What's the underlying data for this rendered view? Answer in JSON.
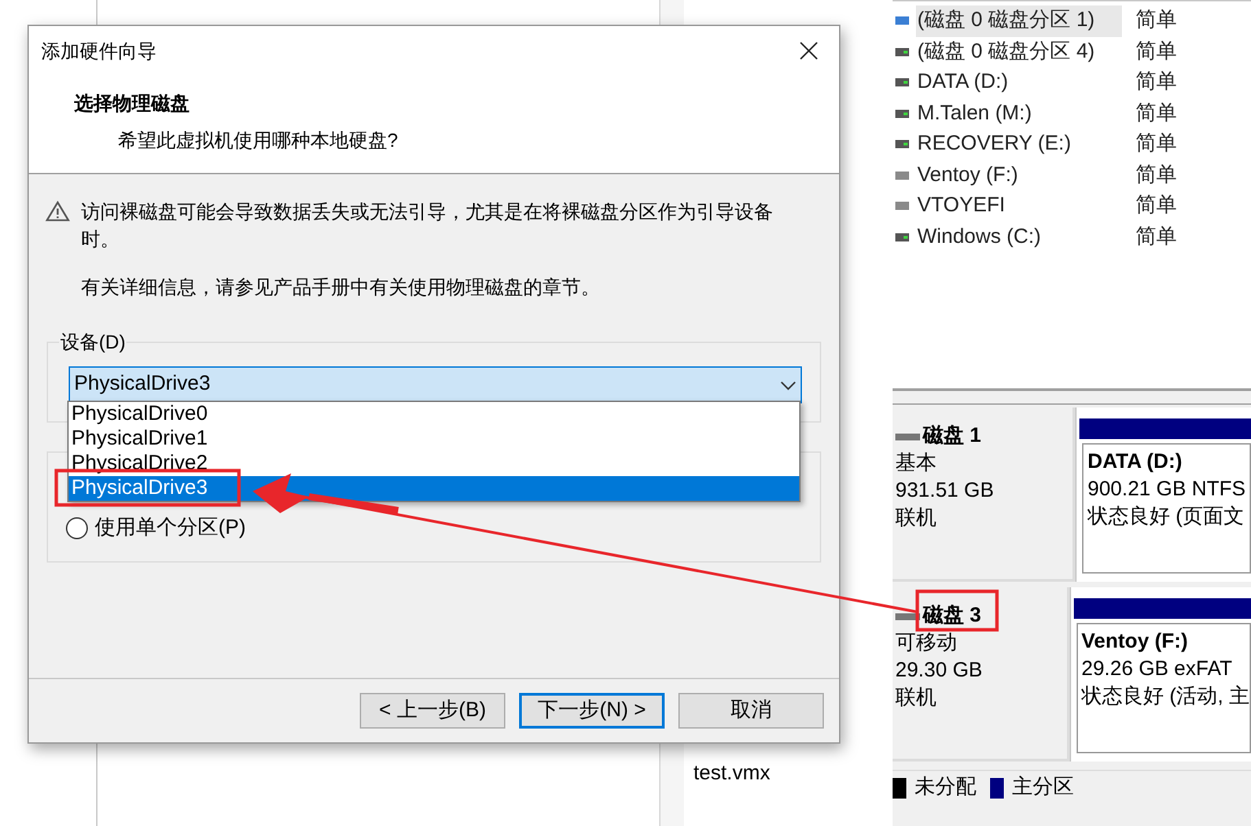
{
  "background_window": {
    "file": "test.vmx"
  },
  "dialog": {
    "title": "添加硬件向导",
    "heading": "选择物理磁盘",
    "subheading": "希望此虚拟机使用哪种本地硬盘?",
    "warning": "访问裸磁盘可能会导致数据丢失或无法引导，尤其是在将裸磁盘分区作为引导设备时。",
    "info": "有关详细信息，请参见产品手册中有关使用物理磁盘的章节。",
    "device": {
      "label": "设备(D)",
      "value": "PhysicalDrive3",
      "options": [
        {
          "label": "PhysicalDrive0",
          "selected": false
        },
        {
          "label": "PhysicalDrive1",
          "selected": false
        },
        {
          "label": "PhysicalDrive2",
          "selected": false
        },
        {
          "label": "PhysicalDrive3",
          "selected": true
        }
      ]
    },
    "partition_option": {
      "label": "使用单个分区(P)",
      "selected": false
    },
    "buttons": [
      {
        "label": "< 上一步(B)",
        "default": false
      },
      {
        "label": "下一步(N) >",
        "default": true
      },
      {
        "label": "取消",
        "default": false
      }
    ]
  },
  "volumes": [
    {
      "name": "(磁盘 0 磁盘分区 1)",
      "layout": "简单",
      "kind": "system",
      "selected": true
    },
    {
      "name": "(磁盘 0 磁盘分区 4)",
      "layout": "简单",
      "kind": "basic",
      "selected": false
    },
    {
      "name": "DATA (D:)",
      "layout": "简单",
      "kind": "basic",
      "selected": false
    },
    {
      "name": "M.Talen (M:)",
      "layout": "简单",
      "kind": "basic",
      "selected": false
    },
    {
      "name": "RECOVERY (E:)",
      "layout": "简单",
      "kind": "basic",
      "selected": false
    },
    {
      "name": "Ventoy (F:)",
      "layout": "简单",
      "kind": "removable",
      "selected": false
    },
    {
      "name": "VTOYEFI",
      "layout": "简单",
      "kind": "removable",
      "selected": false
    },
    {
      "name": "Windows (C:)",
      "layout": "简单",
      "kind": "basic",
      "selected": false
    }
  ],
  "disks": [
    {
      "name": "磁盘 1",
      "type": "基本",
      "size": "931.51 GB",
      "status": "联机",
      "partition": {
        "name": "DATA  (D:)",
        "size": "900.21 GB NTFS",
        "state": "状态良好 (页面文"
      }
    },
    {
      "name": "磁盘 3",
      "type": "可移动",
      "size": "29.30 GB",
      "status": "联机",
      "partition": {
        "name": "Ventoy  (F:)",
        "size": "29.26 GB exFAT",
        "state": "状态良好 (活动, 主"
      }
    }
  ],
  "legend": [
    {
      "label": "未分配",
      "color": "#000000"
    },
    {
      "label": "主分区",
      "color": "#000080"
    }
  ]
}
